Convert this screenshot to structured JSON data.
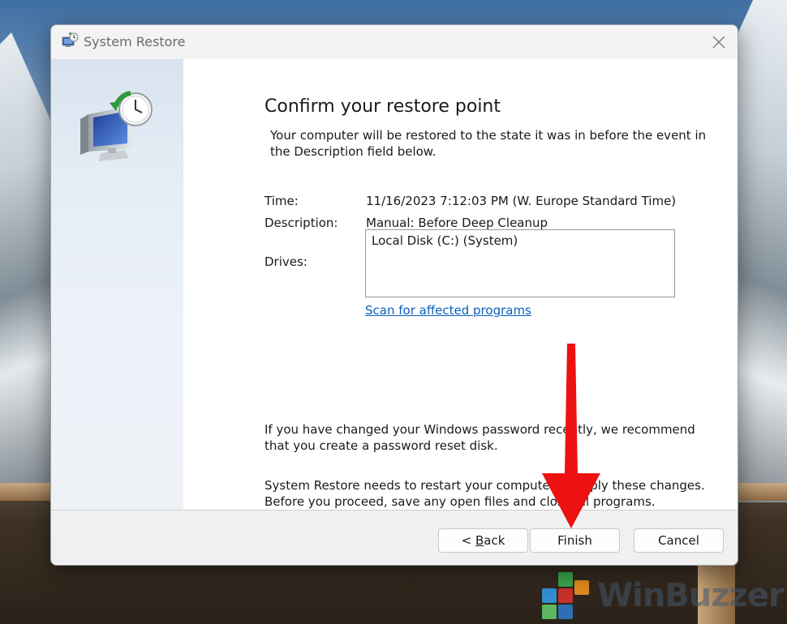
{
  "window": {
    "title": "System Restore",
    "close_glyph": "✕"
  },
  "main": {
    "heading": "Confirm your restore point",
    "intro": "Your computer will be restored to the state it was in before the event in the Description field below.",
    "time_label": "Time:",
    "time_value": "11/16/2023 7:12:03 PM (W. Europe Standard Time)",
    "description_label": "Description:",
    "description_value": "Manual: Before Deep Cleanup",
    "drives_label": "Drives:",
    "drives": [
      "Local Disk (C:) (System)"
    ],
    "scan_link": "Scan for affected programs",
    "password_note": "If you have changed your Windows password recently, we recommend that you create a password reset disk.",
    "restart_note": "System Restore needs to restart your computer to apply these changes. Before you proceed, save any open files and close all programs."
  },
  "footer": {
    "back_prefix": "< ",
    "back_accel": "B",
    "back_rest": "ack",
    "finish_label": "Finish",
    "cancel_label": "Cancel"
  },
  "watermark": {
    "text": "WinBuzzer"
  },
  "colors": {
    "link": "#0a5fbd",
    "arrow": "#ee1111",
    "sidebar_top": "#d9e4f0",
    "footer_bg": "#f0f0f0"
  },
  "icons": {
    "title_icon": "system-restore-icon",
    "sidebar_icon": "monitor-clock-restore-icon",
    "close_icon": "close-icon"
  }
}
